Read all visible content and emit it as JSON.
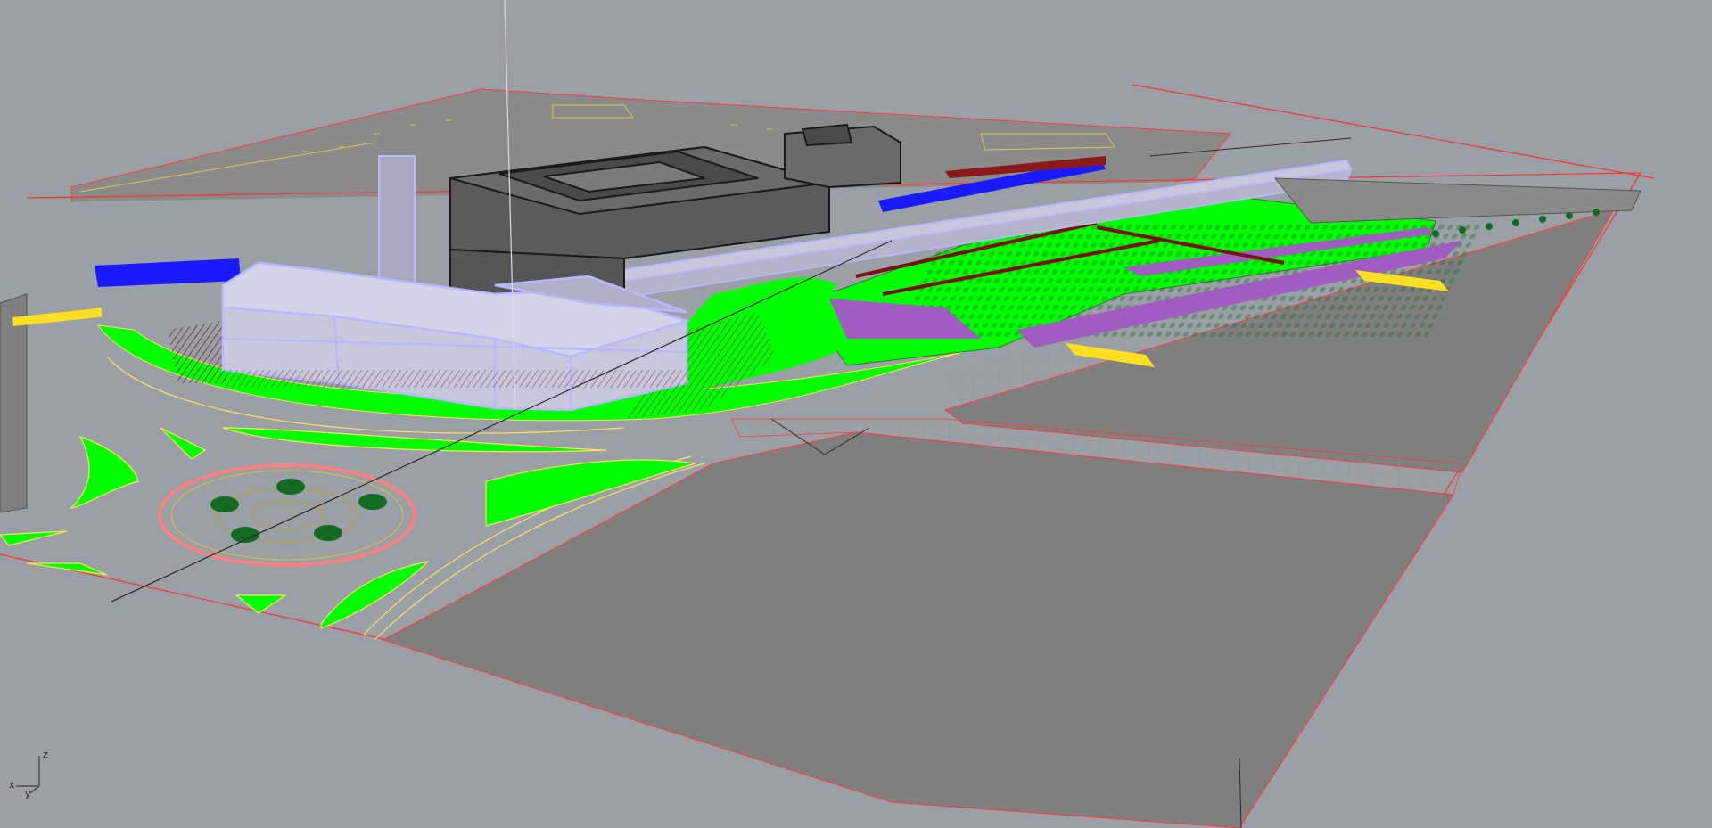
{
  "viewport": {
    "background": "#9aa0a6",
    "axes": {
      "x": "x",
      "y": "y",
      "z": "z"
    }
  },
  "colors": {
    "ground": "#7f7f7f",
    "lawn": "#00ff00",
    "boundary": "#ff2a2a",
    "building_edge": "#b8b8ff",
    "building_fill": "#c8c8dc",
    "dark_building": "#555555",
    "path": "#a05cc0",
    "water": "#1a1aff",
    "tree": "#0f6a1f",
    "crossing": "#ffe020",
    "road_line": "#ffe060",
    "walkway": "#7a1010"
  }
}
